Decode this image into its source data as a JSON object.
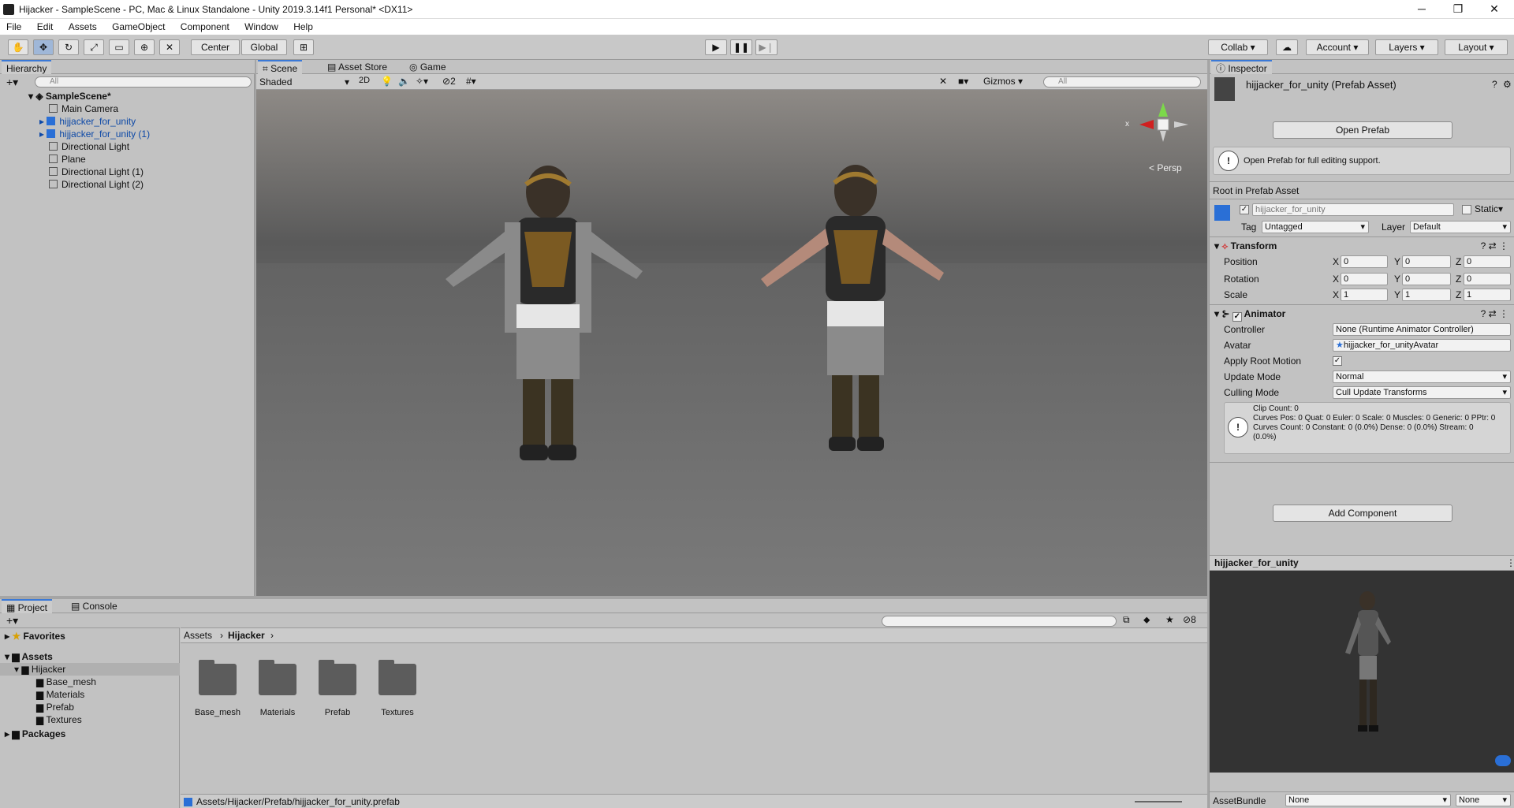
{
  "window": {
    "title": "Hijacker - SampleScene - PC, Mac & Linux Standalone - Unity 2019.3.14f1 Personal* <DX11>",
    "minimize": "─",
    "maximize": "❐",
    "close": "✕"
  },
  "menu": [
    "File",
    "Edit",
    "Assets",
    "GameObject",
    "Component",
    "Window",
    "Help"
  ],
  "toolbar": {
    "pivot": "Center",
    "space": "Global",
    "collab": "Collab ▾",
    "account": "Account",
    "layers": "Layers",
    "layout": "Layout"
  },
  "hierarchy": {
    "tab": "Hierarchy",
    "search_placeholder": "All",
    "scene": "SampleScene*",
    "items": [
      {
        "label": "Main Camera",
        "prefab": false
      },
      {
        "label": "hijjacker_for_unity",
        "prefab": true
      },
      {
        "label": "hijjacker_for_unity (1)",
        "prefab": true
      },
      {
        "label": "Directional Light",
        "prefab": false
      },
      {
        "label": "Plane",
        "prefab": false
      },
      {
        "label": "Directional Light (1)",
        "prefab": false
      },
      {
        "label": "Directional Light (2)",
        "prefab": false
      }
    ]
  },
  "scene_tabs": [
    "Scene",
    "Asset Store",
    "Game"
  ],
  "scene_toolbar": {
    "shading": "Shaded",
    "mode2d": "2D",
    "hidden_count": "2",
    "gizmos": "Gizmos",
    "search_placeholder": "All",
    "persp": "< Persp",
    "axis_x": "x"
  },
  "inspector": {
    "tab": "Inspector",
    "asset_title": "hijjacker_for_unity (Prefab Asset)",
    "open_prefab": "Open Prefab",
    "open_prefab_help": "Open Prefab for full editing support.",
    "root_label": "Root in Prefab Asset",
    "object_name": "hijjacker_for_unity",
    "static": "Static",
    "tag_label": "Tag",
    "tag_value": "Untagged",
    "layer_label": "Layer",
    "layer_value": "Default",
    "transform": {
      "title": "Transform",
      "position_label": "Position",
      "rotation_label": "Rotation",
      "scale_label": "Scale",
      "axis_labels": [
        "X",
        "Y",
        "Z"
      ],
      "position": [
        "0",
        "0",
        "0"
      ],
      "rotation": [
        "0",
        "0",
        "0"
      ],
      "scale": [
        "1",
        "1",
        "1"
      ]
    },
    "animator": {
      "title": "Animator",
      "controller_label": "Controller",
      "controller_value": "None (Runtime Animator Controller)",
      "avatar_label": "Avatar",
      "avatar_value": "hijjacker_for_unityAvatar",
      "root_motion_label": "Apply Root Motion",
      "update_mode_label": "Update Mode",
      "update_mode_value": "Normal",
      "culling_label": "Culling Mode",
      "culling_value": "Cull Update Transforms",
      "info_line1": "Clip Count: 0",
      "info_line2": "Curves Pos: 0 Quat: 0 Euler: 0 Scale: 0 Muscles: 0 Generic: 0 PPtr: 0",
      "info_line3": "Curves Count: 0 Constant: 0 (0.0%) Dense: 0 (0.0%) Stream: 0",
      "info_line4": "(0.0%)"
    },
    "add_component": "Add Component",
    "preview_title": "hijjacker_for_unity",
    "asset_bundle_label": "AssetBundle",
    "asset_bundle_value": "None",
    "asset_bundle_variant": "None"
  },
  "project": {
    "tabs": [
      "Project",
      "Console"
    ],
    "favorites": "Favorites",
    "assets": "Assets",
    "hijacker": "Hijacker",
    "subfolders": [
      "Base_mesh",
      "Materials",
      "Prefab",
      "Textures"
    ],
    "packages": "Packages",
    "breadcrumb_root": "Assets",
    "breadcrumb_current": "Hijacker",
    "folders": [
      "Base_mesh",
      "Materials",
      "Prefab",
      "Textures"
    ],
    "hidden_count": "8",
    "status_path": "Assets/Hijacker/Prefab/hijjacker_for_unity.prefab"
  }
}
